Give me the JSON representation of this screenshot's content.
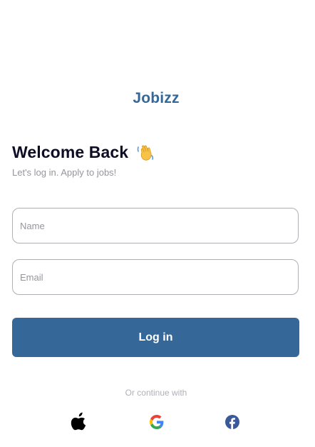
{
  "app": {
    "brand": "Jobizz"
  },
  "header": {
    "title": "Welcome Back",
    "emoji_icon": "waving-hand-icon",
    "subtitle": "Let's log in. Apply to jobs!"
  },
  "form": {
    "name": {
      "placeholder": "Name",
      "value": ""
    },
    "email": {
      "placeholder": "Email",
      "value": ""
    },
    "submit_label": "Log in"
  },
  "social": {
    "divider_text": "Or continue with",
    "providers": [
      {
        "name": "Apple",
        "icon": "apple-icon"
      },
      {
        "name": "Google",
        "icon": "google-icon"
      },
      {
        "name": "Facebook",
        "icon": "facebook-icon"
      }
    ]
  },
  "colors": {
    "primary": "#356899",
    "title": "#0d0d26",
    "muted": "#95969d",
    "border": "#afb0b6"
  }
}
